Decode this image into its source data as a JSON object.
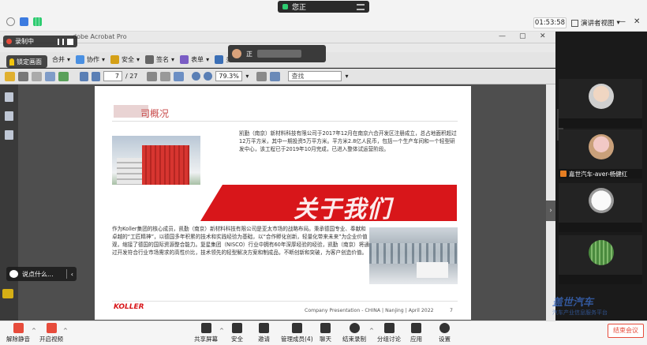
{
  "meeting": {
    "speaking_label": "您正",
    "timer": "01:53:58",
    "view_label": "演讲者视图",
    "rec_label": "录制中",
    "lock_label": "锁定画面",
    "speaker_float_label": "正",
    "chat_label": "说点什么...",
    "end_label": "结束会议"
  },
  "acrobat": {
    "title": "dobe Acrobat Pro",
    "tools": [
      "合并",
      "协作",
      "安全",
      "签名",
      "表单",
      "多"
    ],
    "page_current": "7",
    "page_total": "/ 27",
    "zoom": "79.3%",
    "search_placeholder": "查找"
  },
  "slide": {
    "heading": "司概况",
    "intro": "凯勤（南京）新材料科技有限公司于2017年12月在南京六合开发区注册成立，总占地面积超过12万平方米，其中一期投资5万平方米。平方米2.8亿人民币，包括一个生产车间和一个轻型研发中心，该工程已于2019年10月完成，已进入整体试运营阶段。",
    "banner_text": "关于我们",
    "body": "作为Koller集团的核心成员，凯勤（南京）新材料科技有限公司是亚太市场的战略布局。秉承德国专业、奉献和卓越的“工匠精神”，以德国多年积累的技术和实践经验为基础，以“合作孵化创新，轻量化带来未来”为企业价值观，缩接了德国的国际资源整合能力。复星集团（NISCO）行业中拥有60年深厚经验的经验，凯勤（南京）将通过开发符合行业市场需求的高性价比，技术领先的轻型解决方案和制成品，不断创新和突破，为客户创造价值。",
    "logo": "KOLLER",
    "footer": "Company Presentation - CHINA | Nanjing | April 2022",
    "page": "7"
  },
  "participants": [
    {
      "name": ""
    },
    {
      "name": "嘉世汽车-aver-杨健红"
    },
    {
      "name": ""
    },
    {
      "name": ""
    }
  ],
  "toolbar": {
    "mute": "解除静音",
    "video": "开启视频",
    "share": "共享屏幕",
    "security": "安全",
    "invite": "邀请",
    "members": "管理成员(4)",
    "chat": "聊天",
    "end_record": "结束录制",
    "breakout": "分组讨论",
    "apps": "应用",
    "settings": "设置"
  },
  "watermark": {
    "main": "盖世汽车",
    "sub": "汽车产业信息服务平台"
  },
  "colors": {
    "brand_red": "#d8161a",
    "rec_red": "#e74c3c",
    "speaking_green": "#2ecc71"
  }
}
